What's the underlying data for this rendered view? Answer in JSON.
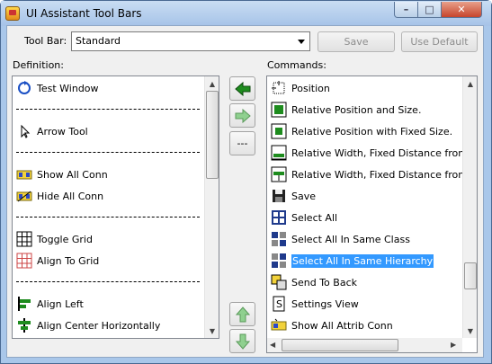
{
  "window": {
    "title": "UI Assistant Tool Bars",
    "minimize": "–",
    "maximize": "□",
    "close": "✕"
  },
  "toolbar": {
    "label": "Tool Bar:",
    "selected": "Standard",
    "save": "Save",
    "use_default": "Use Default"
  },
  "definition": {
    "label": "Definition:",
    "items": [
      {
        "label": "Test Window",
        "icon": "refresh-icon"
      },
      {
        "label": "Arrow Tool",
        "icon": "arrow-pointer-icon"
      },
      {
        "label": "Show All Conn",
        "icon": "show-conn-icon"
      },
      {
        "label": "Hide All Conn",
        "icon": "hide-conn-icon"
      },
      {
        "label": "Toggle Grid",
        "icon": "grid-icon"
      },
      {
        "label": "Align To Grid",
        "icon": "align-grid-icon"
      },
      {
        "label": "Align Left",
        "icon": "align-left-icon"
      },
      {
        "label": "Align Center Horizontally",
        "icon": "align-center-icon"
      }
    ]
  },
  "commands": {
    "label": "Commands:",
    "items": [
      {
        "label": "Position",
        "icon": "position-icon"
      },
      {
        "label": "Relative Position and Size.",
        "icon": "rel-pos-size-icon"
      },
      {
        "label": "Relative Position with Fixed Size.",
        "icon": "rel-pos-fixed-icon"
      },
      {
        "label": "Relative Width, Fixed Distance from",
        "icon": "rel-width-icon"
      },
      {
        "label": "Relative Width, Fixed Distance from",
        "icon": "rel-width-icon"
      },
      {
        "label": "Save",
        "icon": "save-icon"
      },
      {
        "label": "Select All",
        "icon": "select-all-icon"
      },
      {
        "label": "Select All In Same Class",
        "icon": "select-class-icon"
      },
      {
        "label": "Select All In Same Hierarchy",
        "icon": "select-hierarchy-icon",
        "selected": true
      },
      {
        "label": "Send To Back",
        "icon": "send-back-icon"
      },
      {
        "label": "Settings View",
        "icon": "settings-view-icon"
      },
      {
        "label": "Show All Attrib Conn",
        "icon": "show-attrib-conn-icon"
      }
    ]
  },
  "middle_buttons": {
    "separator_label": "---"
  },
  "colors": {
    "accent_green": "#1e8c1e",
    "selection": "#3399ff"
  }
}
